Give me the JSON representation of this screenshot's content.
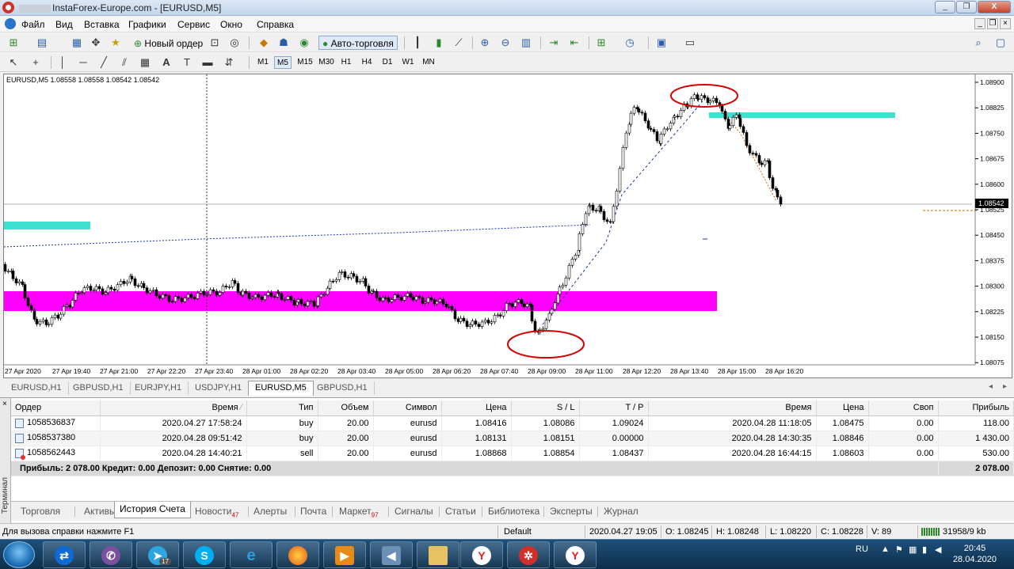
{
  "window": {
    "title": "InstaForex-Europe.com - [EURUSD,M5]",
    "min": "_",
    "restore": "❐",
    "close": "X"
  },
  "menu": [
    "Файл",
    "Вид",
    "Вставка",
    "Графики",
    "Сервис",
    "Окно",
    "Справка"
  ],
  "toolbar": {
    "new_order": "Новый ордер",
    "auto_trading": "Авто-торговля"
  },
  "timeframes": [
    "M1",
    "M5",
    "M15",
    "M30",
    "H1",
    "H4",
    "D1",
    "W1",
    "MN"
  ],
  "active_timeframe": "M5",
  "chart": {
    "header": "EURUSD,M5  1.08558 1.08558 1.08542 1.08542",
    "current_price": "1.08542",
    "price_levels": [
      "1.08900",
      "1.08825",
      "1.08750",
      "1.08675",
      "1.08600",
      "1.08525",
      "1.08450",
      "1.08375",
      "1.08300",
      "1.08225",
      "1.08150",
      "1.08075"
    ],
    "time_labels": [
      "27 Apr 2020",
      "27 Apr 19:40",
      "27 Apr 21:00",
      "27 Apr 22:20",
      "27 Apr 23:40",
      "28 Apr 01:00",
      "28 Apr 02:20",
      "28 Apr 03:40",
      "28 Apr 05:00",
      "28 Apr 06:20",
      "28 Apr 07:40",
      "28 Apr 09:00",
      "28 Apr 11:00",
      "28 Apr 12:20",
      "28 Apr 13:40",
      "28 Apr 15:00",
      "28 Apr 16:20"
    ],
    "colors": {
      "zone_magenta": "#ff00ff",
      "zone_cyan": "#40e0d0",
      "circle": "#d40000",
      "trend": "#1a2fa8",
      "candle": "#000000"
    }
  },
  "chart_tabs": [
    "EURUSD,H1",
    "GBPUSD,H1",
    "EURJPY,H1",
    "USDJPY,H1",
    "EURUSD,M5",
    "GBPUSD,H1"
  ],
  "active_chart_tab": "EURUSD,M5",
  "terminal": {
    "side_label": "Терминал",
    "columns": [
      "Ордер",
      "Время",
      "Тип",
      "Объем",
      "Символ",
      "Цена",
      "S / L",
      "T / P",
      "Время",
      "Цена",
      "Своп",
      "Прибыль"
    ],
    "rows": [
      {
        "order": "1058536837",
        "time": "2020.04.27 17:58:24",
        "type": "buy",
        "volume": "20.00",
        "symbol": "eurusd",
        "price": "1.08416",
        "sl": "1.08086",
        "tp": "1.09024",
        "close_time": "2020.04.28 11:18:05",
        "close_price": "1.08475",
        "swap": "0.00",
        "profit": "118.00"
      },
      {
        "order": "1058537380",
        "time": "2020.04.28 09:51:42",
        "type": "buy",
        "volume": "20.00",
        "symbol": "eurusd",
        "price": "1.08131",
        "sl": "1.08151",
        "tp": "0.00000",
        "close_time": "2020.04.28 14:30:35",
        "close_price": "1.08846",
        "swap": "0.00",
        "profit": "1 430.00"
      },
      {
        "order": "1058562443",
        "time": "2020.04.28 14:40:21",
        "type": "sell",
        "volume": "20.00",
        "symbol": "eurusd",
        "price": "1.08868",
        "sl": "1.08854",
        "tp": "1.08437",
        "close_time": "2020.04.28 16:44:15",
        "close_price": "1.08603",
        "swap": "0.00",
        "profit": "530.00"
      }
    ],
    "summary": "Прибыль: 2 078.00  Кредит: 0.00  Депозит: 0.00  Снятие: 0.00",
    "summary_total": "2 078.00",
    "tabs": [
      {
        "label": "Торговля",
        "count": ""
      },
      {
        "label": "Активы",
        "count": ""
      },
      {
        "label": "История Счета",
        "count": ""
      },
      {
        "label": "Новости",
        "count": "47"
      },
      {
        "label": "Алерты",
        "count": ""
      },
      {
        "label": "Почта",
        "count": ""
      },
      {
        "label": "Маркет",
        "count": "97"
      },
      {
        "label": "Сигналы",
        "count": ""
      },
      {
        "label": "Статьи",
        "count": ""
      },
      {
        "label": "Библиотека",
        "count": ""
      },
      {
        "label": "Эксперты",
        "count": ""
      },
      {
        "label": "Журнал",
        "count": ""
      }
    ],
    "active_tab": "История Счета"
  },
  "status": {
    "help": "Для вызова справки нажмите F1",
    "profile": "Default",
    "datetime": "2020.04.27 19:05",
    "open": "O: 1.08245",
    "high": "H: 1.08248",
    "low": "L: 1.08220",
    "close": "C: 1.08228",
    "volume": "V: 89",
    "traffic": "31958/9 kb"
  },
  "taskbar": {
    "apps": [
      "teamviewer",
      "viber",
      "telegram",
      "skype",
      "ie",
      "firefox",
      "media",
      "sound",
      "explorer",
      "yandex",
      "instaforex",
      "yandex-browser"
    ],
    "telegram_badge": "17",
    "lang": "RU",
    "time": "20:45",
    "date": "28.04.2020"
  }
}
